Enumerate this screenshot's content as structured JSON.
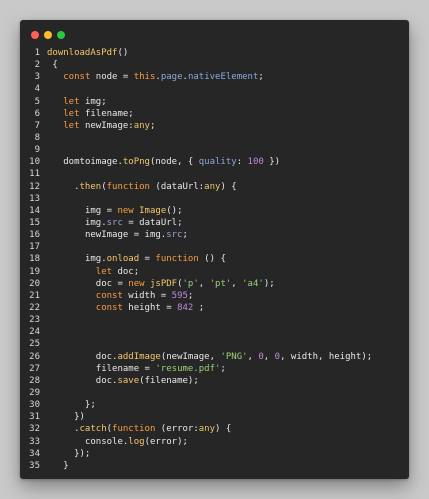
{
  "window": {
    "controls": [
      {
        "name": "close",
        "color": "#ff5f56"
      },
      {
        "name": "minimize",
        "color": "#ffbd2e"
      },
      {
        "name": "maximize",
        "color": "#27c93f"
      }
    ]
  },
  "code_lines": [
    {
      "n": "1",
      "tokens": [
        [
          "fn",
          "downloadAsPdf"
        ],
        [
          "punc",
          "()"
        ]
      ]
    },
    {
      "n": "2",
      "tokens": [
        [
          "punc",
          " {"
        ]
      ]
    },
    {
      "n": "3",
      "tokens": [
        [
          "punc",
          "   "
        ],
        [
          "kw",
          "const"
        ],
        [
          "id",
          " node = "
        ],
        [
          "kw",
          "this"
        ],
        [
          "punc",
          "."
        ],
        [
          "prop",
          "page"
        ],
        [
          "punc",
          "."
        ],
        [
          "prop",
          "nativeElement"
        ],
        [
          "punc",
          ";"
        ]
      ]
    },
    {
      "n": "4",
      "tokens": []
    },
    {
      "n": "5",
      "tokens": [
        [
          "punc",
          "   "
        ],
        [
          "kw",
          "let"
        ],
        [
          "id",
          " img;"
        ]
      ]
    },
    {
      "n": "6",
      "tokens": [
        [
          "punc",
          "   "
        ],
        [
          "kw",
          "let"
        ],
        [
          "id",
          " filename;"
        ]
      ]
    },
    {
      "n": "7",
      "tokens": [
        [
          "punc",
          "   "
        ],
        [
          "kw",
          "let"
        ],
        [
          "id",
          " newImage:"
        ],
        [
          "type",
          "any"
        ],
        [
          "punc",
          ";"
        ]
      ]
    },
    {
      "n": "8",
      "tokens": []
    },
    {
      "n": "9",
      "tokens": []
    },
    {
      "n": "10",
      "tokens": [
        [
          "punc",
          "   "
        ],
        [
          "id",
          "domtoimage."
        ],
        [
          "fn",
          "toPng"
        ],
        [
          "punc",
          "(node, { "
        ],
        [
          "prop",
          "quality"
        ],
        [
          "punc",
          ": "
        ],
        [
          "num",
          "100"
        ],
        [
          "punc",
          " })"
        ]
      ]
    },
    {
      "n": "11",
      "tokens": []
    },
    {
      "n": "12",
      "tokens": [
        [
          "punc",
          "     ."
        ],
        [
          "fn",
          "then"
        ],
        [
          "punc",
          "("
        ],
        [
          "kw",
          "function"
        ],
        [
          "punc",
          " (dataUrl:"
        ],
        [
          "type",
          "any"
        ],
        [
          "punc",
          ") {"
        ]
      ]
    },
    {
      "n": "13",
      "tokens": []
    },
    {
      "n": "14",
      "tokens": [
        [
          "punc",
          "       "
        ],
        [
          "id",
          "img = "
        ],
        [
          "kw",
          "new"
        ],
        [
          "punc",
          " "
        ],
        [
          "fn",
          "Image"
        ],
        [
          "punc",
          "();"
        ]
      ]
    },
    {
      "n": "15",
      "tokens": [
        [
          "punc",
          "       "
        ],
        [
          "id",
          "img."
        ],
        [
          "prop",
          "src"
        ],
        [
          "punc",
          " = dataUrl;"
        ]
      ]
    },
    {
      "n": "16",
      "tokens": [
        [
          "punc",
          "       "
        ],
        [
          "id",
          "newImage = img."
        ],
        [
          "prop",
          "src"
        ],
        [
          "punc",
          ";"
        ]
      ]
    },
    {
      "n": "17",
      "tokens": []
    },
    {
      "n": "18",
      "tokens": [
        [
          "punc",
          "       "
        ],
        [
          "id",
          "img."
        ],
        [
          "fn",
          "onload"
        ],
        [
          "punc",
          " = "
        ],
        [
          "kw",
          "function"
        ],
        [
          "punc",
          " () {"
        ]
      ]
    },
    {
      "n": "19",
      "tokens": [
        [
          "punc",
          "         "
        ],
        [
          "kw",
          "let"
        ],
        [
          "id",
          " doc;"
        ]
      ]
    },
    {
      "n": "20",
      "tokens": [
        [
          "punc",
          "         "
        ],
        [
          "id",
          "doc = "
        ],
        [
          "kw",
          "new"
        ],
        [
          "punc",
          " "
        ],
        [
          "fn",
          "jsPDF"
        ],
        [
          "punc",
          "("
        ],
        [
          "str",
          "'p'"
        ],
        [
          "punc",
          ", "
        ],
        [
          "str",
          "'pt'"
        ],
        [
          "punc",
          ", "
        ],
        [
          "str",
          "'a4'"
        ],
        [
          "punc",
          ");"
        ]
      ]
    },
    {
      "n": "21",
      "tokens": [
        [
          "punc",
          "         "
        ],
        [
          "kw",
          "const"
        ],
        [
          "id",
          " width = "
        ],
        [
          "num",
          "595"
        ],
        [
          "punc",
          ";"
        ]
      ]
    },
    {
      "n": "22",
      "tokens": [
        [
          "punc",
          "         "
        ],
        [
          "kw",
          "const"
        ],
        [
          "id",
          " height = "
        ],
        [
          "num",
          "842"
        ],
        [
          "punc",
          " ;"
        ]
      ]
    },
    {
      "n": "23",
      "tokens": []
    },
    {
      "n": "24",
      "tokens": []
    },
    {
      "n": "25",
      "tokens": []
    },
    {
      "n": "26",
      "tokens": [
        [
          "punc",
          "         "
        ],
        [
          "id",
          "doc."
        ],
        [
          "fn",
          "addImage"
        ],
        [
          "punc",
          "(newImage, "
        ],
        [
          "str",
          "'PNG'"
        ],
        [
          "punc",
          ", "
        ],
        [
          "num",
          "0"
        ],
        [
          "punc",
          ", "
        ],
        [
          "num",
          "0"
        ],
        [
          "punc",
          ", width, height);"
        ]
      ]
    },
    {
      "n": "27",
      "tokens": [
        [
          "punc",
          "         "
        ],
        [
          "id",
          "filename = "
        ],
        [
          "str",
          "'resume.pdf'"
        ],
        [
          "punc",
          ";"
        ]
      ]
    },
    {
      "n": "28",
      "tokens": [
        [
          "punc",
          "         "
        ],
        [
          "id",
          "doc."
        ],
        [
          "fn",
          "save"
        ],
        [
          "punc",
          "(filename);"
        ]
      ]
    },
    {
      "n": "29",
      "tokens": []
    },
    {
      "n": "30",
      "tokens": [
        [
          "punc",
          "       };"
        ]
      ]
    },
    {
      "n": "31",
      "tokens": [
        [
          "punc",
          "     })"
        ]
      ]
    },
    {
      "n": "32",
      "tokens": [
        [
          "punc",
          "     ."
        ],
        [
          "fn",
          "catch"
        ],
        [
          "punc",
          "("
        ],
        [
          "kw",
          "function"
        ],
        [
          "punc",
          " (error:"
        ],
        [
          "type",
          "any"
        ],
        [
          "punc",
          ") {"
        ]
      ]
    },
    {
      "n": "33",
      "tokens": [
        [
          "punc",
          "       "
        ],
        [
          "id",
          "console."
        ],
        [
          "fn",
          "log"
        ],
        [
          "punc",
          "(error);"
        ]
      ]
    },
    {
      "n": "34",
      "tokens": [
        [
          "punc",
          "     });"
        ]
      ]
    },
    {
      "n": "35",
      "tokens": [
        [
          "punc",
          "   }"
        ]
      ]
    }
  ]
}
